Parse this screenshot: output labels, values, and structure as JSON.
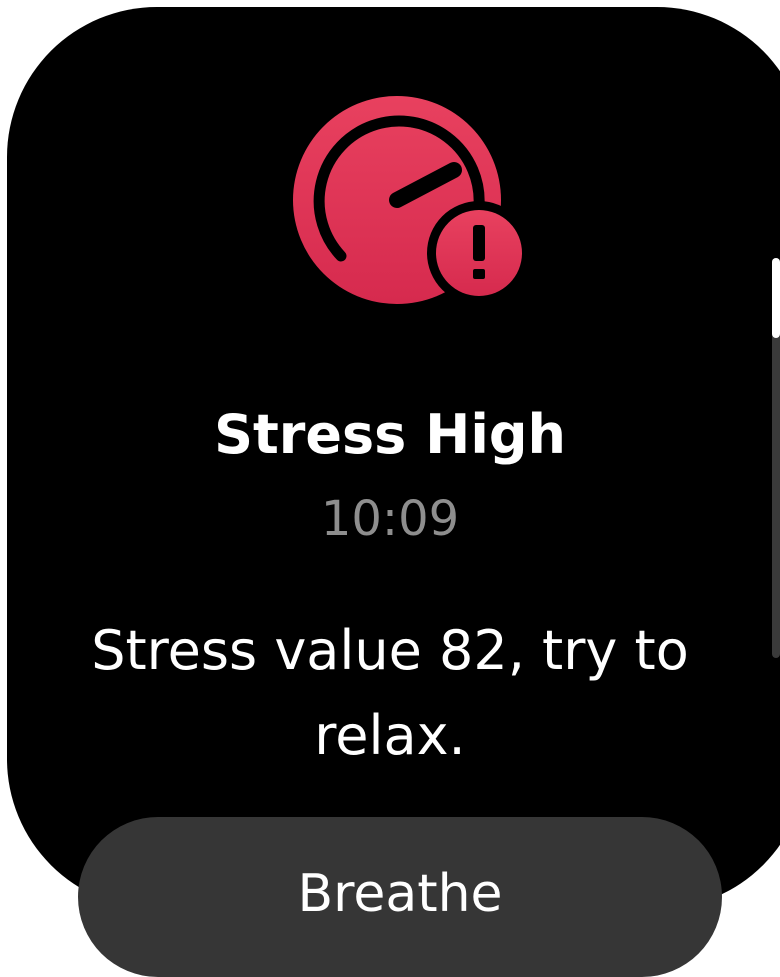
{
  "notification": {
    "icon": "stress-gauge-alert-icon",
    "title": "Stress High",
    "time": "10:09",
    "message": "Stress value 82, try to relax.",
    "action_label": "Breathe"
  },
  "colors": {
    "background": "#000000",
    "accent": "#e0335a",
    "secondary_text": "#8e8e8e",
    "button_bg": "#363636"
  }
}
